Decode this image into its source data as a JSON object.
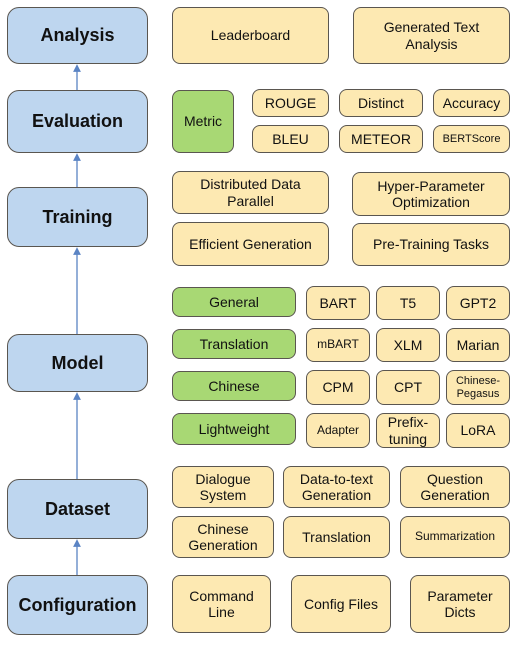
{
  "colors": {
    "stage": "#bed6ef",
    "item": "#fde9b2",
    "category": "#a8d874",
    "arrow": "#5b84c4"
  },
  "stages": [
    "Analysis",
    "Evaluation",
    "Training",
    "Model",
    "Dataset",
    "Configuration"
  ],
  "analysis": [
    "Leaderboard",
    "Generated Text Analysis"
  ],
  "evaluation": {
    "category": "Metric",
    "metrics": [
      "ROUGE",
      "Distinct",
      "Accuracy",
      "BLEU",
      "METEOR",
      "BERTScore"
    ]
  },
  "training": [
    "Distributed Data Parallel",
    "Hyper-Parameter Optimization",
    "Efficient Generation",
    "Pre-Training Tasks"
  ],
  "model": {
    "categories": [
      "General",
      "Translation",
      "Chinese",
      "Lightweight"
    ],
    "models": [
      "BART",
      "T5",
      "GPT2",
      "mBART",
      "XLM",
      "Marian",
      "CPM",
      "CPT",
      "Chinese-Pegasus",
      "Adapter",
      "Prefix-tuning",
      "LoRA"
    ]
  },
  "dataset": [
    "Dialogue System",
    "Data-to-text Generation",
    "Question Generation",
    "Chinese Generation",
    "Translation",
    "Summarization"
  ],
  "configuration": [
    "Command Line",
    "Config Files",
    "Parameter Dicts"
  ]
}
